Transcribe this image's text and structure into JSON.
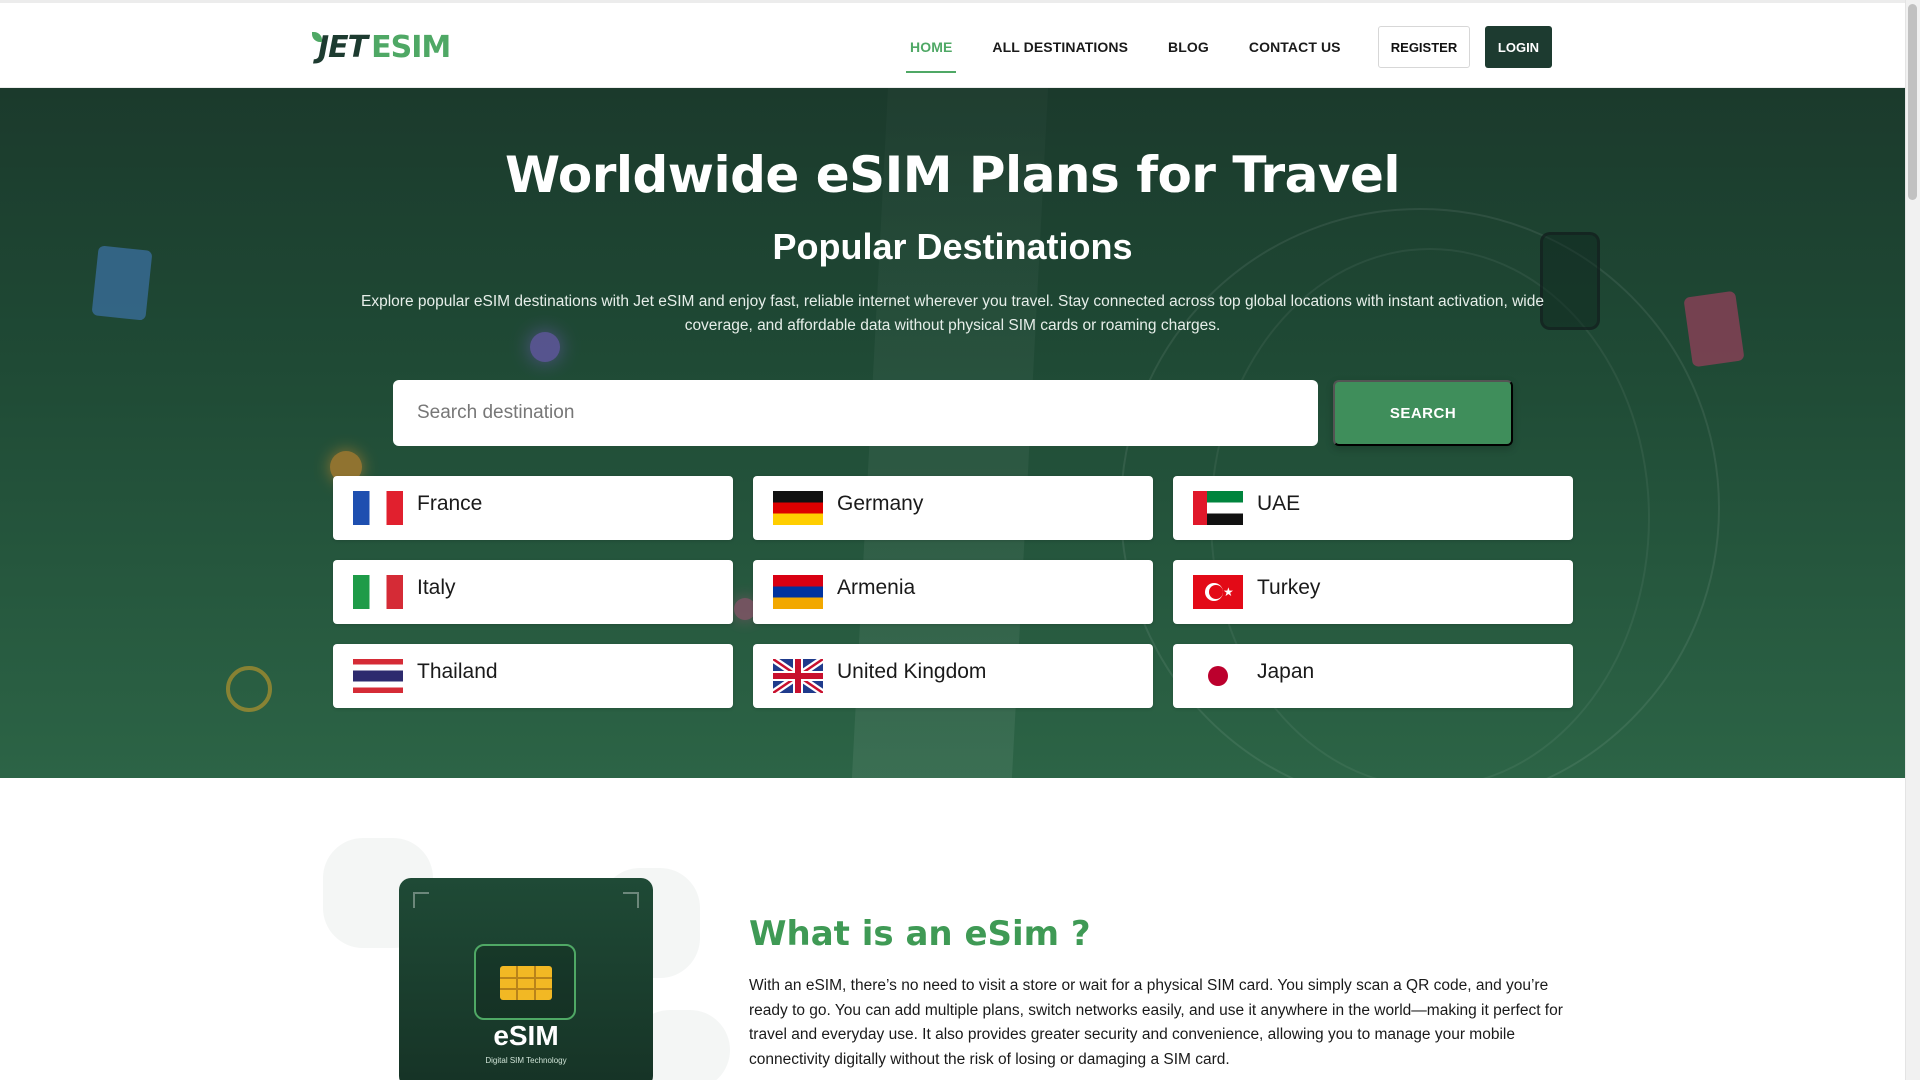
{
  "logo": {
    "part1": "JET",
    "part2": "ESIM"
  },
  "nav": {
    "items": [
      {
        "label": "HOME",
        "active": true
      },
      {
        "label": "ALL DESTINATIONS",
        "active": false
      },
      {
        "label": "BLOG",
        "active": false
      },
      {
        "label": "CONTACT US",
        "active": false
      }
    ],
    "register_label": "REGISTER",
    "login_label": "LOGIN"
  },
  "hero": {
    "title": "Worldwide eSIM Plans for Travel",
    "subtitle": "Popular Destinations",
    "description": "Explore popular eSIM destinations with Jet eSIM and enjoy fast, reliable internet wherever you travel. Stay connected across top global locations with instant activation, wide coverage, and affordable data without physical SIM cards or roaming charges.",
    "search_placeholder": "Search destination",
    "search_button": "SEARCH"
  },
  "destinations": [
    {
      "name": "France",
      "flag": "france-flag-icon"
    },
    {
      "name": "Germany",
      "flag": "germany-flag-icon"
    },
    {
      "name": "UAE",
      "flag": "uae-flag-icon"
    },
    {
      "name": "Italy",
      "flag": "italy-flag-icon"
    },
    {
      "name": "Armenia",
      "flag": "armenia-flag-icon"
    },
    {
      "name": "Turkey",
      "flag": "turkey-flag-icon"
    },
    {
      "name": "Thailand",
      "flag": "thailand-flag-icon"
    },
    {
      "name": "United Kingdom",
      "flag": "uk-flag-icon"
    },
    {
      "name": "Japan",
      "flag": "japan-flag-icon"
    }
  ],
  "about": {
    "card_label": "eSIM",
    "card_sublabel": "Digital SIM Technology",
    "title": "What is an eSim ?",
    "text": "With an eSIM, there’s no need to visit a store or wait for a physical SIM card. You simply scan a QR code, and you’re ready to go. You can add multiple plans, switch networks easily, and use it anywhere in the world—making it perfect for travel and everyday use. It also provides greater security and convenience, allowing you to manage your mobile connectivity digitally without the risk of losing or damaging a SIM card."
  },
  "colors": {
    "brand_dark": "#1d3b30",
    "brand_green": "#4fa865",
    "hero_bg": "#1f4a35",
    "search_button": "#3f8e5b"
  }
}
